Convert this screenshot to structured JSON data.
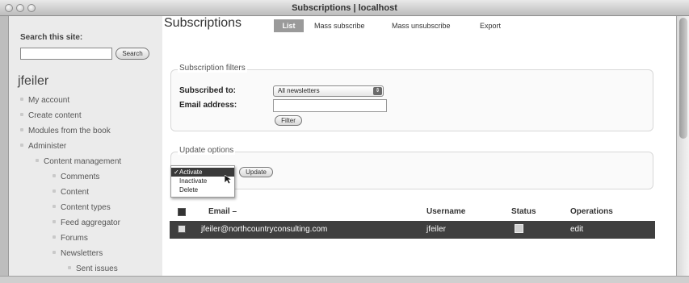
{
  "window": {
    "title": "Subscriptions | localhost"
  },
  "sidebar": {
    "search_label": "Search this site:",
    "search_value": "",
    "search_button": "Search",
    "user_name": "jfeiler",
    "nav": [
      {
        "label": "My account"
      },
      {
        "label": "Create content"
      },
      {
        "label": "Modules from the book"
      },
      {
        "label": "Administer"
      },
      {
        "label": "Content management"
      },
      {
        "label": "Comments"
      },
      {
        "label": "Content"
      },
      {
        "label": "Content types"
      },
      {
        "label": "Feed aggregator"
      },
      {
        "label": "Forums"
      },
      {
        "label": "Newsletters"
      },
      {
        "label": "Sent issues"
      }
    ]
  },
  "main": {
    "title": "Subscriptions",
    "tabs": [
      {
        "label": "List"
      },
      {
        "label": "Mass subscribe"
      },
      {
        "label": "Mass unsubscribe"
      },
      {
        "label": "Export"
      }
    ],
    "filters": {
      "legend": "Subscription filters",
      "subscribed_label": "Subscribed to:",
      "subscribed_value": "All newsletters",
      "email_label": "Email address:",
      "email_value": "",
      "filter_button": "Filter"
    },
    "update": {
      "legend": "Update options",
      "options": [
        "Activate",
        "Inactivate",
        "Delete"
      ],
      "selected": "Activate",
      "update_button": "Update"
    },
    "table": {
      "headers": {
        "email": "Email –",
        "username": "Username",
        "status": "Status",
        "operations": "Operations"
      },
      "rows": [
        {
          "email": "jfeiler@northcountryconsulting.com",
          "username": "jfeiler",
          "operation": "edit"
        }
      ]
    }
  }
}
